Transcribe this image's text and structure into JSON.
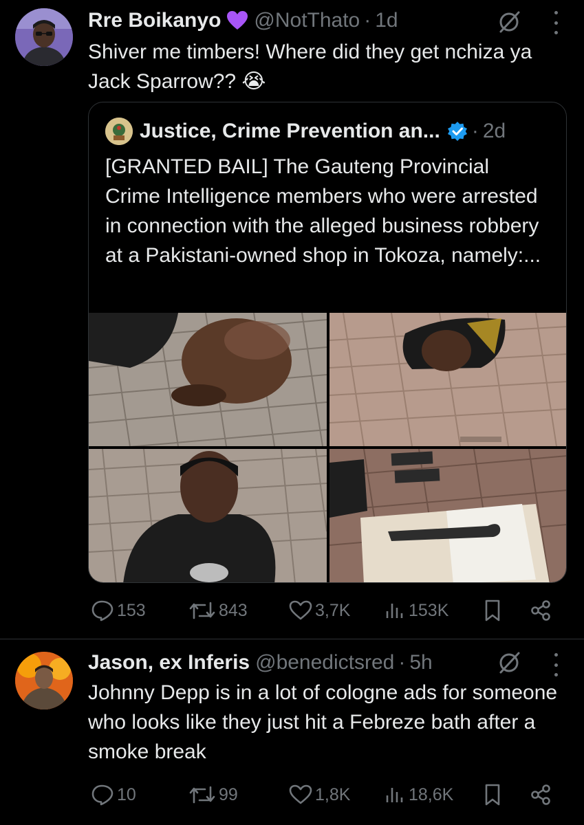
{
  "tweets": [
    {
      "name": "Rre Boikanyo",
      "handle": "@NotThato",
      "separator": "·",
      "time": "1d",
      "text": "Shiver me timbers! Where did they get nchiza ya Jack Sparrow?? 😭",
      "quoted": {
        "name": "Justice, Crime Prevention an...",
        "separator": "·",
        "time": "2d",
        "text": "[GRANTED BAIL] The Gauteng Provincial Crime Intelligence members who were arrested in connection with the alleged business robbery at a Pakistani-owned shop in Tokoza, namely:..."
      },
      "stats": {
        "replies": "153",
        "reposts": "843",
        "likes": "3,7K",
        "views": "153K"
      }
    },
    {
      "name": "Jason, ex Inferis",
      "handle": "@benedictsred",
      "separator": "·",
      "time": "5h",
      "text": "Johnny Depp is in a lot of cologne ads for someone who looks like they just hit a Febreze bath after a smoke break",
      "stats": {
        "replies": "10",
        "reposts": "99",
        "likes": "1,8K",
        "views": "18,6K"
      }
    }
  ],
  "icons": {
    "reply": "reply-icon",
    "repost": "repost-icon",
    "like": "like-icon",
    "views": "views-icon",
    "bookmark": "bookmark-icon",
    "share": "share-icon",
    "grok": "grok-icon",
    "more": "more-icon",
    "verified": "verified-badge-icon",
    "heart_emoji": "purple-heart-icon"
  },
  "colors": {
    "background": "#000000",
    "text": "#e7e9ea",
    "muted": "#71767b",
    "verified": "#1d9bf0",
    "heart": "#a855f7",
    "border": "#2f3336"
  }
}
